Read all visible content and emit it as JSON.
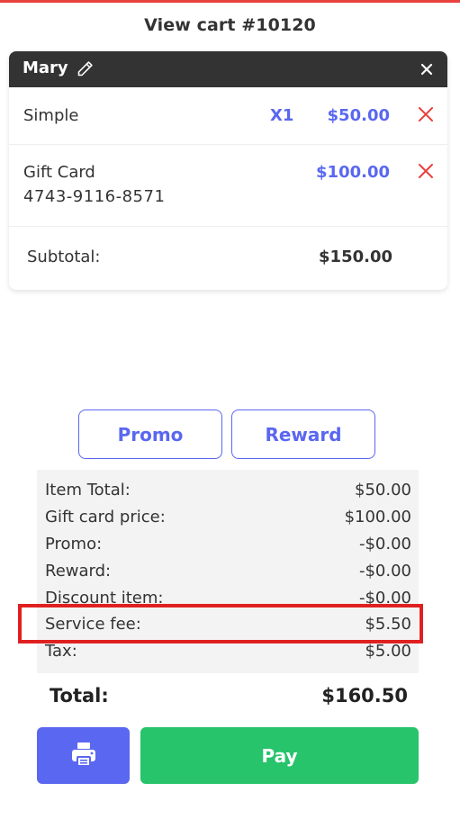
{
  "page": {
    "title": "View cart #10120"
  },
  "cart": {
    "customer_name": "Mary",
    "items": [
      {
        "name": "Simple",
        "sub": "",
        "qty": "X1",
        "price": "$50.00"
      },
      {
        "name": "Gift Card",
        "sub": "4743-9116-8571",
        "qty": "",
        "price": "$100.00"
      }
    ],
    "subtotal_label": "Subtotal:",
    "subtotal_value": "$150.00"
  },
  "actions": {
    "promo_label": "Promo",
    "reward_label": "Reward",
    "pay_label": "Pay"
  },
  "summary": {
    "rows": [
      {
        "label": "Item Total:",
        "value": "$50.00"
      },
      {
        "label": "Gift card price:",
        "value": "$100.00"
      },
      {
        "label": "Promo:",
        "value": "-$0.00"
      },
      {
        "label": "Reward:",
        "value": "-$0.00"
      },
      {
        "label": "Discount item:",
        "value": "-$0.00"
      },
      {
        "label": "Service fee:",
        "value": "$5.50"
      },
      {
        "label": "Tax:",
        "value": "$5.00"
      }
    ],
    "total_label": "Total:",
    "total_value": "$160.50"
  },
  "colors": {
    "accent": "#5a67f0",
    "pay": "#27c46b",
    "remove": "#e8413e",
    "highlight": "#e02020",
    "header": "#333333"
  },
  "icons": {
    "edit": "pencil-icon",
    "close": "close-icon",
    "remove": "remove-x-icon",
    "print": "printer-icon"
  }
}
